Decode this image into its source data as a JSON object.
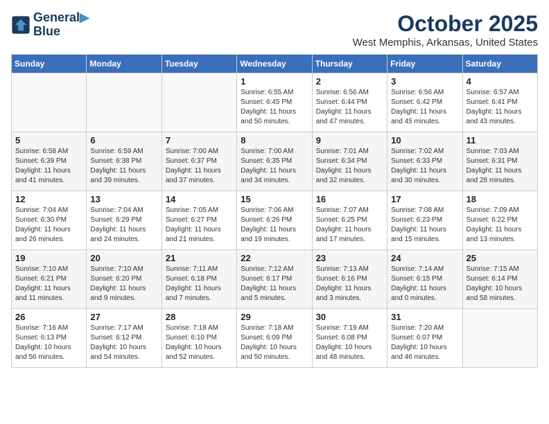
{
  "logo": {
    "line1": "General",
    "line2": "Blue"
  },
  "calendar": {
    "title": "October 2025",
    "subtitle": "West Memphis, Arkansas, United States"
  },
  "weekdays": [
    "Sunday",
    "Monday",
    "Tuesday",
    "Wednesday",
    "Thursday",
    "Friday",
    "Saturday"
  ],
  "weeks": [
    [
      {
        "day": null,
        "info": null
      },
      {
        "day": null,
        "info": null
      },
      {
        "day": null,
        "info": null
      },
      {
        "day": "1",
        "info": "Sunrise: 6:55 AM\nSunset: 6:45 PM\nDaylight: 11 hours\nand 50 minutes."
      },
      {
        "day": "2",
        "info": "Sunrise: 6:56 AM\nSunset: 6:44 PM\nDaylight: 11 hours\nand 47 minutes."
      },
      {
        "day": "3",
        "info": "Sunrise: 6:56 AM\nSunset: 6:42 PM\nDaylight: 11 hours\nand 45 minutes."
      },
      {
        "day": "4",
        "info": "Sunrise: 6:57 AM\nSunset: 6:41 PM\nDaylight: 11 hours\nand 43 minutes."
      }
    ],
    [
      {
        "day": "5",
        "info": "Sunrise: 6:58 AM\nSunset: 6:39 PM\nDaylight: 11 hours\nand 41 minutes."
      },
      {
        "day": "6",
        "info": "Sunrise: 6:59 AM\nSunset: 6:38 PM\nDaylight: 11 hours\nand 39 minutes."
      },
      {
        "day": "7",
        "info": "Sunrise: 7:00 AM\nSunset: 6:37 PM\nDaylight: 11 hours\nand 37 minutes."
      },
      {
        "day": "8",
        "info": "Sunrise: 7:00 AM\nSunset: 6:35 PM\nDaylight: 11 hours\nand 34 minutes."
      },
      {
        "day": "9",
        "info": "Sunrise: 7:01 AM\nSunset: 6:34 PM\nDaylight: 11 hours\nand 32 minutes."
      },
      {
        "day": "10",
        "info": "Sunrise: 7:02 AM\nSunset: 6:33 PM\nDaylight: 11 hours\nand 30 minutes."
      },
      {
        "day": "11",
        "info": "Sunrise: 7:03 AM\nSunset: 6:31 PM\nDaylight: 11 hours\nand 28 minutes."
      }
    ],
    [
      {
        "day": "12",
        "info": "Sunrise: 7:04 AM\nSunset: 6:30 PM\nDaylight: 11 hours\nand 26 minutes."
      },
      {
        "day": "13",
        "info": "Sunrise: 7:04 AM\nSunset: 6:29 PM\nDaylight: 11 hours\nand 24 minutes."
      },
      {
        "day": "14",
        "info": "Sunrise: 7:05 AM\nSunset: 6:27 PM\nDaylight: 11 hours\nand 21 minutes."
      },
      {
        "day": "15",
        "info": "Sunrise: 7:06 AM\nSunset: 6:26 PM\nDaylight: 11 hours\nand 19 minutes."
      },
      {
        "day": "16",
        "info": "Sunrise: 7:07 AM\nSunset: 6:25 PM\nDaylight: 11 hours\nand 17 minutes."
      },
      {
        "day": "17",
        "info": "Sunrise: 7:08 AM\nSunset: 6:23 PM\nDaylight: 11 hours\nand 15 minutes."
      },
      {
        "day": "18",
        "info": "Sunrise: 7:09 AM\nSunset: 6:22 PM\nDaylight: 11 hours\nand 13 minutes."
      }
    ],
    [
      {
        "day": "19",
        "info": "Sunrise: 7:10 AM\nSunset: 6:21 PM\nDaylight: 11 hours\nand 11 minutes."
      },
      {
        "day": "20",
        "info": "Sunrise: 7:10 AM\nSunset: 6:20 PM\nDaylight: 11 hours\nand 9 minutes."
      },
      {
        "day": "21",
        "info": "Sunrise: 7:11 AM\nSunset: 6:18 PM\nDaylight: 11 hours\nand 7 minutes."
      },
      {
        "day": "22",
        "info": "Sunrise: 7:12 AM\nSunset: 6:17 PM\nDaylight: 11 hours\nand 5 minutes."
      },
      {
        "day": "23",
        "info": "Sunrise: 7:13 AM\nSunset: 6:16 PM\nDaylight: 11 hours\nand 3 minutes."
      },
      {
        "day": "24",
        "info": "Sunrise: 7:14 AM\nSunset: 6:15 PM\nDaylight: 11 hours\nand 0 minutes."
      },
      {
        "day": "25",
        "info": "Sunrise: 7:15 AM\nSunset: 6:14 PM\nDaylight: 10 hours\nand 58 minutes."
      }
    ],
    [
      {
        "day": "26",
        "info": "Sunrise: 7:16 AM\nSunset: 6:13 PM\nDaylight: 10 hours\nand 56 minutes."
      },
      {
        "day": "27",
        "info": "Sunrise: 7:17 AM\nSunset: 6:12 PM\nDaylight: 10 hours\nand 54 minutes."
      },
      {
        "day": "28",
        "info": "Sunrise: 7:18 AM\nSunset: 6:10 PM\nDaylight: 10 hours\nand 52 minutes."
      },
      {
        "day": "29",
        "info": "Sunrise: 7:18 AM\nSunset: 6:09 PM\nDaylight: 10 hours\nand 50 minutes."
      },
      {
        "day": "30",
        "info": "Sunrise: 7:19 AM\nSunset: 6:08 PM\nDaylight: 10 hours\nand 48 minutes."
      },
      {
        "day": "31",
        "info": "Sunrise: 7:20 AM\nSunset: 6:07 PM\nDaylight: 10 hours\nand 46 minutes."
      },
      {
        "day": null,
        "info": null
      }
    ]
  ]
}
